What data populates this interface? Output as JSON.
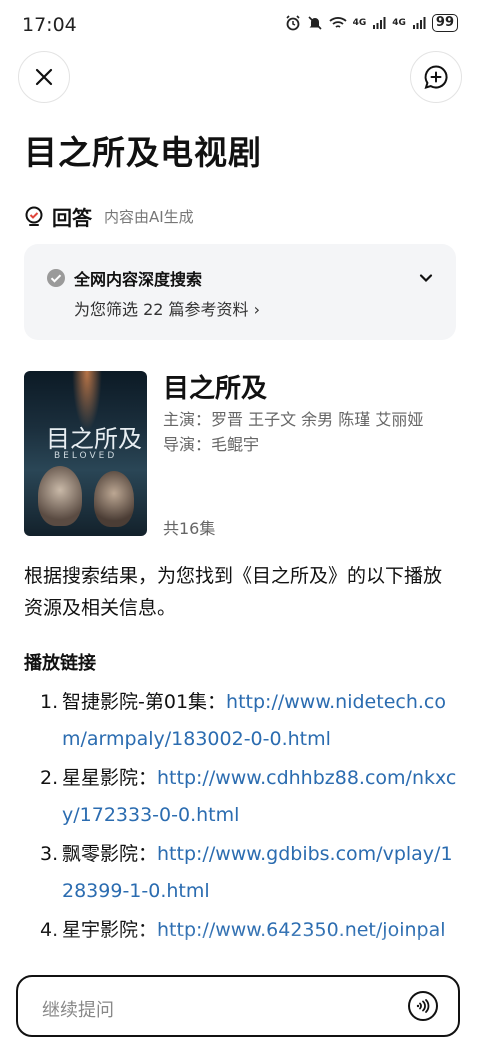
{
  "status_bar": {
    "time": "17:04",
    "network_1": "4G",
    "network_2": "4G",
    "battery": "99"
  },
  "page_title": "目之所及电视剧",
  "answer": {
    "label": "回答",
    "note": "内容由AI生成"
  },
  "search_card": {
    "title": "全网内容深度搜索",
    "subtitle": "为您筛选 22 篇参考资料 ›"
  },
  "show": {
    "title": "目之所及",
    "cast": "主演：罗晋 王子文 余男 陈瑾 艾丽娅",
    "director": "导演：毛鲲宇",
    "episodes": "共16集",
    "poster_title": "目之所及",
    "poster_subtitle": "BELOVED"
  },
  "summary": "根据搜索结果，为您找到《目之所及》的以下播放资源及相关信息。",
  "links_heading": "播放链接",
  "links": [
    {
      "num": "1.",
      "site": "智捷影院-第01集：",
      "url": "http://www.nidetech.com/armpaly/183002-0-0.html"
    },
    {
      "num": "2.",
      "site": "星星影院：",
      "url": "http://www.cdhhbz88.com/nkxcy/172333-0-0.html"
    },
    {
      "num": "3.",
      "site": "飘零影院：",
      "url": "http://www.gdbibs.com/vplay/128399-1-0.html"
    },
    {
      "num": "4.",
      "site": "星宇影院：",
      "url": "http://www.642350.net/joinpal"
    }
  ],
  "input": {
    "placeholder": "继续提问"
  },
  "icons": {
    "close": "close-icon",
    "new_chat": "chat-plus-icon",
    "answer": "bulb-icon",
    "search_check": "check-circle-icon",
    "expand": "chevron-down-icon",
    "voice": "voice-wave-icon"
  }
}
